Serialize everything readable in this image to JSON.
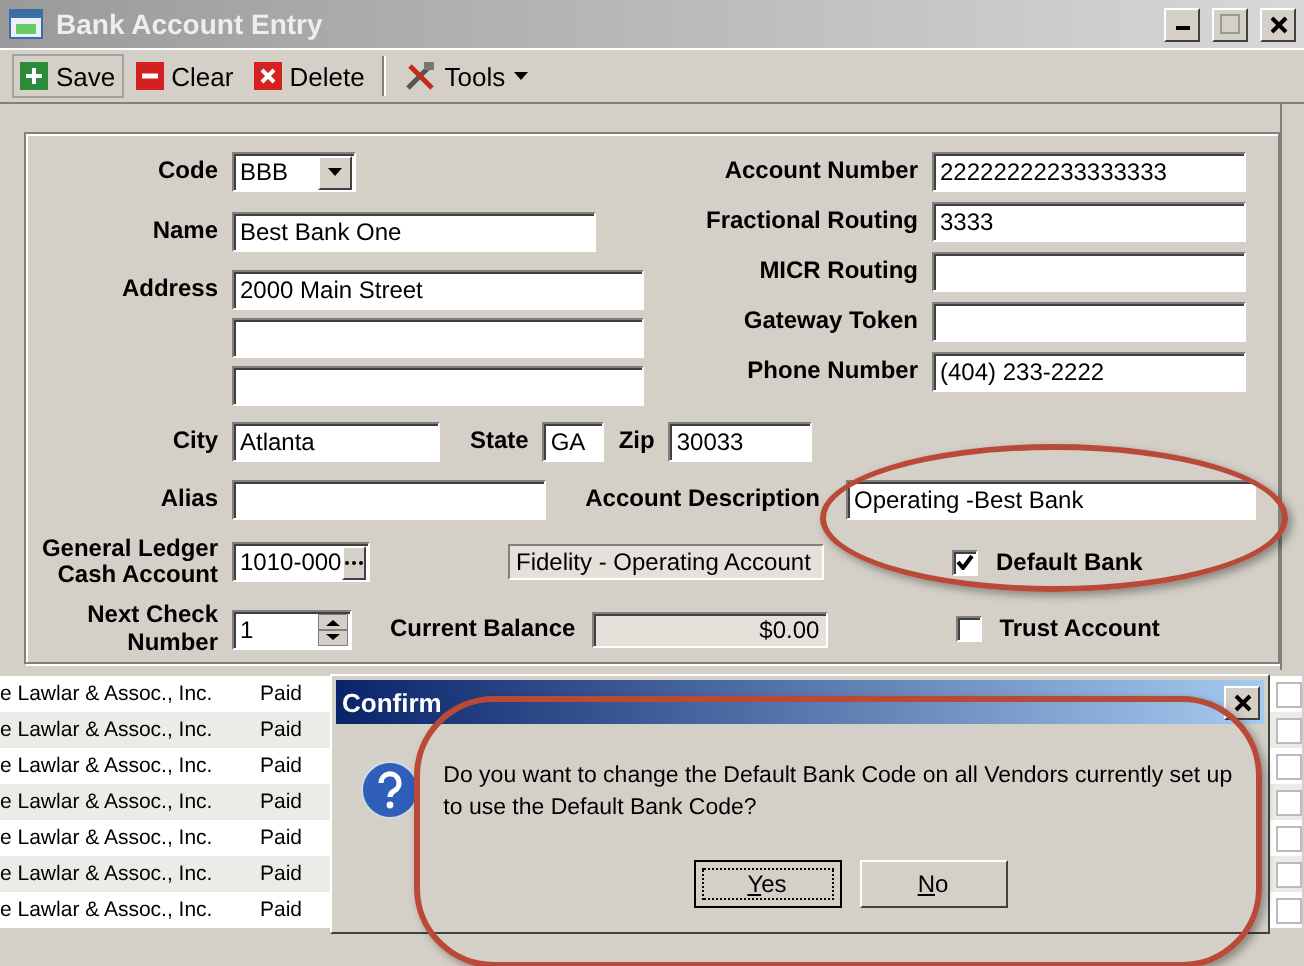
{
  "window": {
    "title": "Bank Account Entry"
  },
  "toolbar": [
    {
      "label": "Save",
      "kind": "save"
    },
    {
      "label": "Clear",
      "kind": "clear"
    },
    {
      "label": "Delete",
      "kind": "delete"
    },
    {
      "label": "Tools",
      "kind": "menu"
    }
  ],
  "form": {
    "code": {
      "label": "Code",
      "value": "BBB"
    },
    "name": {
      "label": "Name",
      "value": "Best Bank One"
    },
    "address": {
      "label": "Address",
      "lines": [
        "2000 Main Street"
      ]
    },
    "right_fields": [
      {
        "label": "Account Number",
        "value": "22222222233333333"
      },
      {
        "label": "Fractional Routing",
        "value": "3333"
      },
      {
        "label": "MICR Routing"
      },
      {
        "label": "Gateway Token"
      },
      {
        "label": "Phone Number",
        "value": "(404) 233-2222"
      }
    ],
    "city": {
      "label": "City",
      "value": "Atlanta"
    },
    "state": {
      "label": "State",
      "value": "GA"
    },
    "zip": {
      "label": "Zip",
      "value": "30033"
    },
    "alias": {
      "label": "Alias"
    },
    "account_description": {
      "label": "Account Description",
      "value": "Operating -Best Bank"
    },
    "gl_account": {
      "label": "General Ledger Cash Account",
      "value": "1010-000",
      "description": "Fidelity - Operating Account"
    },
    "default_bank": {
      "label": "Default Bank",
      "checked": true
    },
    "next_check": {
      "label": "Next Check Number",
      "value": "1"
    },
    "current_balance": {
      "label": "Current Balance",
      "value": "$0.00"
    },
    "trust_account": {
      "label": "Trust Account",
      "checked": false
    }
  },
  "payments": [
    {
      "vendor": "e Lawlar & Assoc., Inc.",
      "status": "Paid",
      "checked": false
    },
    {
      "vendor": "e Lawlar & Assoc., Inc.",
      "status": "Paid",
      "checked": false
    },
    {
      "vendor": "e Lawlar & Assoc., Inc.",
      "status": "Paid",
      "checked": false
    },
    {
      "vendor": "e Lawlar & Assoc., Inc.",
      "status": "Paid",
      "checked": false
    },
    {
      "vendor": "e Lawlar & Assoc., Inc.",
      "status": "Paid",
      "checked": false
    },
    {
      "vendor": "e Lawlar & Assoc., Inc.",
      "status": "Paid",
      "checked": false
    },
    {
      "vendor": "e Lawlar & Assoc., Inc.",
      "status": "Paid",
      "checked": false
    }
  ],
  "dialog": {
    "title": "Confirm",
    "message": "Do you want to change the Default Bank Code on all Vendors currently set up to use the Default Bank Code?",
    "buttons": [
      {
        "label": "Yes",
        "selected": true
      },
      {
        "label": "No",
        "selected": false
      }
    ]
  }
}
